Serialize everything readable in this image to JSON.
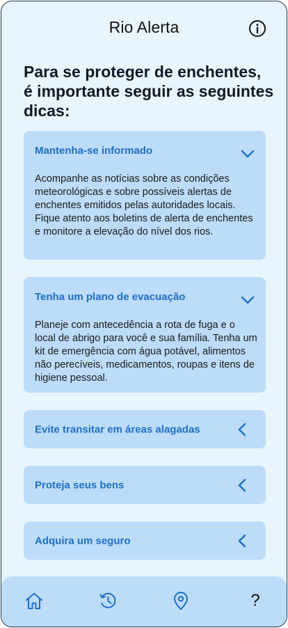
{
  "header": {
    "title": "Rio Alerta",
    "info_icon": "info-icon"
  },
  "intro": {
    "heading": "Para se proteger de enchentes, é importante seguir as seguintes dicas:"
  },
  "tips": [
    {
      "title": "Mantenha-se informado",
      "expanded": true,
      "body": "Acompanhe as notícias sobre as condições meteorológicas e sobre possíveis alertas de enchentes emitidos pelas autoridades locais. Fique atento aos boletins de alerta de enchentes e monitore a elevação do nível dos rios."
    },
    {
      "title": "Tenha um plano de evacuação",
      "expanded": true,
      "body": "Planeje com antecedência a rota de fuga e o local de abrigo para você e sua família. Tenha um kit de emergência com água potável, alimentos não perecíveis, medicamentos, roupas e itens de higiene pessoal."
    },
    {
      "title": "Evite transitar em áreas alagadas",
      "expanded": false
    },
    {
      "title": "Proteja seus bens",
      "expanded": false
    },
    {
      "title": "Adquira um seguro",
      "expanded": false
    }
  ],
  "bottom_nav": {
    "items": [
      "home-icon",
      "history-icon",
      "location-pin-icon",
      "help-icon"
    ],
    "help_label": "?"
  },
  "colors": {
    "background": "#e9f5fd",
    "card": "#bcdcf9",
    "accent": "#1f6fc2",
    "nav_icon": "#1f6fc2"
  }
}
